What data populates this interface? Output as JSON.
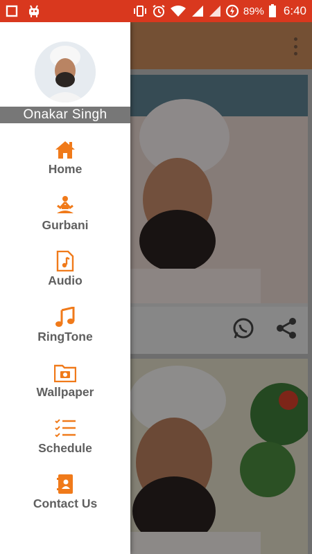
{
  "status_bar": {
    "battery": "89%",
    "time": "6:40",
    "icons": [
      "stop-icon",
      "android-debug-icon",
      "vibrate-icon",
      "alarm-icon",
      "wifi-icon",
      "signal-icon",
      "roaming-icon",
      "data-saver-icon",
      "battery-icon"
    ]
  },
  "drawer": {
    "user_name": "Onakar  Singh",
    "items": [
      {
        "label": "Home",
        "icon": "home-icon"
      },
      {
        "label": "Gurbani",
        "icon": "meditation-icon"
      },
      {
        "label": "Audio",
        "icon": "audio-file-icon"
      },
      {
        "label": "RingTone",
        "icon": "music-note-icon"
      },
      {
        "label": "Wallpaper",
        "icon": "camera-folder-icon"
      },
      {
        "label": "Schedule",
        "icon": "checklist-icon"
      },
      {
        "label": "Contact Us",
        "icon": "contact-book-icon"
      }
    ]
  },
  "colors": {
    "status_bar": "#d9381e",
    "accent": "#f07a1a",
    "menu_text": "#5f5f5f",
    "name_bar": "#777777"
  }
}
